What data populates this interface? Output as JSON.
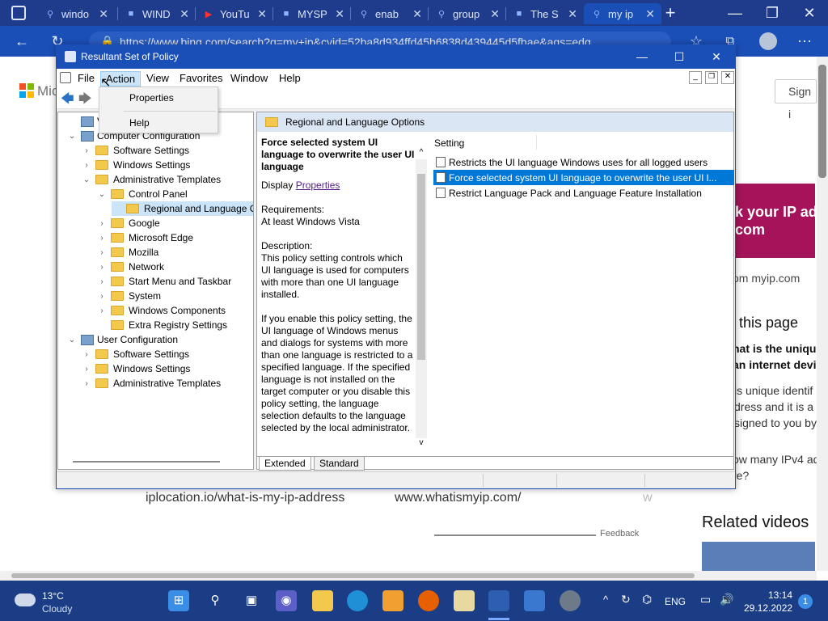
{
  "browser": {
    "tabs": [
      {
        "label": "windo",
        "icon": "search-icon"
      },
      {
        "label": "WIND",
        "icon": "site-icon"
      },
      {
        "label": "YouTu",
        "icon": "youtube-icon"
      },
      {
        "label": "MYSP",
        "icon": "site-icon"
      },
      {
        "label": "enab",
        "icon": "search-icon"
      },
      {
        "label": "group",
        "icon": "search-icon"
      },
      {
        "label": "The S",
        "icon": "site-icon"
      },
      {
        "label": "my ip",
        "icon": "search-icon"
      }
    ],
    "url": "https://www.bing.com/search?q=my+ip&cvid=52ba8d934ffd45b6838d439445d5fbae&aqs=edg"
  },
  "page": {
    "ms_logo": "Mic",
    "sign_in": "Sign i",
    "promo_line1": "k your IP add",
    "promo_line2": "com",
    "myip_link": "om myip.com",
    "about_title": "this page",
    "q1_line1": "hat is the unique",
    "q1_line2": "an internet devi",
    "ans_line1": "is unique identif",
    "ans_line2": "dress and it is a",
    "ans_line3": "signed to you by",
    "q2_line1": "ow many IPv4 ad",
    "q2_line2": "re?",
    "link1": "iplocation.io/what-is-my-ip-address",
    "link2": "www.whatismyip.com/",
    "link3": "w",
    "feedback": "Feedback",
    "related_videos": "Related videos"
  },
  "window": {
    "title": "Resultant Set of Policy",
    "menus": [
      "File",
      "Action",
      "View",
      "Favorites",
      "Window",
      "Help"
    ],
    "dropdown": [
      "Properties",
      "Help"
    ],
    "tree": [
      {
        "label": "VM6",
        "level": 0,
        "chev": ""
      },
      {
        "label": "Computer Configuration",
        "level": 0,
        "chev": "v"
      },
      {
        "label": "Software Settings",
        "level": 1,
        "chev": ">"
      },
      {
        "label": "Windows Settings",
        "level": 1,
        "chev": ">"
      },
      {
        "label": "Administrative Templates",
        "level": 1,
        "chev": "v"
      },
      {
        "label": "Control Panel",
        "level": 2,
        "chev": "v"
      },
      {
        "label": "Regional and Language Op",
        "level": 3,
        "chev": ""
      },
      {
        "label": "Google",
        "level": 2,
        "chev": ">"
      },
      {
        "label": "Microsoft Edge",
        "level": 2,
        "chev": ">"
      },
      {
        "label": "Mozilla",
        "level": 2,
        "chev": ">"
      },
      {
        "label": "Network",
        "level": 2,
        "chev": ">"
      },
      {
        "label": "Start Menu and Taskbar",
        "level": 2,
        "chev": ">"
      },
      {
        "label": "System",
        "level": 2,
        "chev": ">"
      },
      {
        "label": "Windows Components",
        "level": 2,
        "chev": ">"
      },
      {
        "label": "Extra Registry Settings",
        "level": 2,
        "chev": ""
      },
      {
        "label": "User Configuration",
        "level": 0,
        "chev": "v"
      },
      {
        "label": "Software Settings",
        "level": 1,
        "chev": ">"
      },
      {
        "label": "Windows Settings",
        "level": 1,
        "chev": ">"
      },
      {
        "label": "Administrative Templates",
        "level": 1,
        "chev": ">"
      }
    ],
    "right_header": "Regional and Language Options",
    "desc_title": "Force selected system UI language to overwrite the user UI language",
    "display_label": "Display",
    "display_link": "Properties",
    "requirements": "Requirements:",
    "requirements_value": "At least Windows Vista",
    "description_label": "Description:",
    "description_text": "This policy setting controls which UI language is used for computers with more than one UI language installed.",
    "description_text2": "If you enable this policy setting, the UI language of Windows menus and dialogs for systems with more than one language is restricted to a specified language. If the specified language is not installed on the target computer or you disable this policy setting, the language selection defaults to the language selected by the local administrator.",
    "setting_header": "Setting",
    "settings": [
      "Restricts the UI language Windows uses for all logged users",
      "Force selected system UI language to overwrite the user UI l...",
      "Restrict Language Pack and Language Feature Installation"
    ],
    "view_tabs": [
      "Extended",
      "Standard"
    ]
  },
  "taskbar": {
    "temp": "13°C",
    "weather": "Cloudy",
    "lang": "ENG",
    "time": "13:14",
    "date": "29.12.2022",
    "notif": "1"
  }
}
